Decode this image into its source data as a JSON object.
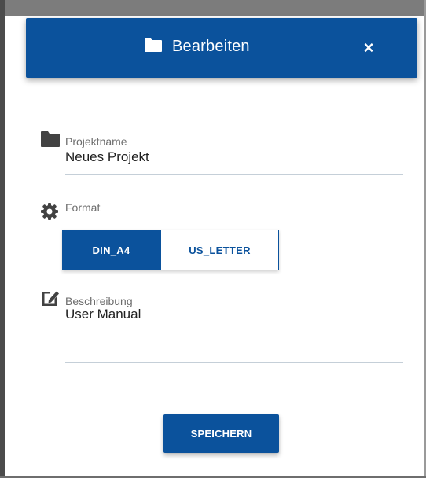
{
  "dialog": {
    "title": "Bearbeiten",
    "title_icon": "folder-icon",
    "close_label": "×"
  },
  "fields": {
    "project_name": {
      "icon": "folder-icon",
      "label": "Projektname",
      "value": "Neues Projekt"
    },
    "format": {
      "icon": "gear-icon",
      "label": "Format",
      "options": [
        "DIN_A4",
        "US_LETTER"
      ],
      "selected": "DIN_A4"
    },
    "description": {
      "icon": "edit-icon",
      "label": "Beschreibung",
      "value": "User Manual"
    }
  },
  "actions": {
    "save_label": "SPEICHERN"
  },
  "colors": {
    "primary": "#0b529c",
    "backdrop": "#7c7c7c",
    "label": "#6d6d6d",
    "underline": "#c5cfd8"
  }
}
